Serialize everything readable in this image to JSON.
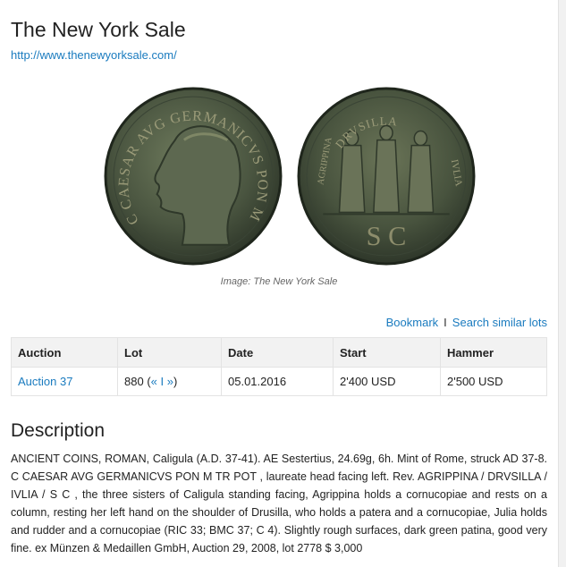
{
  "header": {
    "title": "The New York Sale",
    "url": "http://www.thenewyorksale.com/"
  },
  "image": {
    "caption": "Image: The New York Sale",
    "obverse_legend": "C CAESAR AVG GERMANICVS PON M TR POT",
    "reverse_legend_top": "DRVSILLA",
    "reverse_legend_left": "AGRIPPINA",
    "reverse_legend_right": "IVLIA",
    "reverse_exergue": "S C",
    "colors": {
      "bronze_dark": "#2f3a2c",
      "bronze_mid": "#56614a",
      "bronze_light": "#8a8a6a",
      "link": "#1a7bbf"
    }
  },
  "actions": {
    "bookmark": "Bookmark",
    "separator": "I",
    "search_similar": "Search similar lots"
  },
  "table": {
    "headers": [
      "Auction",
      "Lot",
      "Date",
      "Start",
      "Hammer"
    ],
    "row": {
      "auction": "Auction 37",
      "lot": "880",
      "lot_nav_open": "(",
      "lot_prev": "«",
      "lot_sep": "I",
      "lot_next": "»",
      "lot_nav_close": ")",
      "date": "05.01.2016",
      "start": "2'400 USD",
      "hammer": "2'500 USD"
    }
  },
  "description": {
    "heading": "Description",
    "text": "ANCIENT COINS, ROMAN, Caligula (A.D. 37-41). AE Sestertius, 24.69g, 6h. Mint of Rome, struck AD 37-8. C CAESAR AVG GERMANICVS PON M TR POT , laureate head facing left. Rev. AGRIPPINA / DRVSILLA / IVLIA / S C , the three sisters of Caligula standing facing, Agrippina holds a cornucopiae and rests on a column, resting her left hand on the shoulder of Drusilla, who holds a patera and a cornucopiae, Julia holds and rudder and a cornucopiae (RIC 33; BMC 37; C 4). Slightly rough surfaces, dark green patina, good very fine. ex Münzen & Medaillen GmbH, Auction 29, 2008, lot 2778 $ 3,000"
  }
}
